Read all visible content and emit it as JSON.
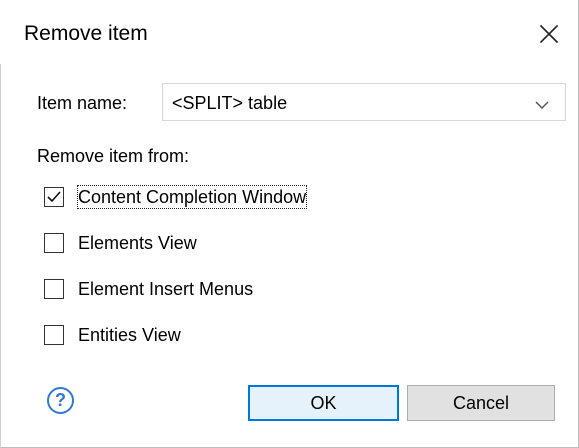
{
  "dialog": {
    "title": "Remove item",
    "close_icon": "close-icon",
    "item_name": {
      "label": "Item name:",
      "value": "<SPLIT> table",
      "dropdown_icon": "chevron-down-icon"
    },
    "remove_from_label": "Remove item from:",
    "options": [
      {
        "label": "Content Completion Window",
        "checked": true
      },
      {
        "label": "Elements View",
        "checked": false
      },
      {
        "label": "Element Insert Menus",
        "checked": false
      },
      {
        "label": "Entities View",
        "checked": false
      }
    ],
    "help_icon": "help-icon",
    "buttons": {
      "ok": "OK",
      "cancel": "Cancel"
    }
  },
  "colors": {
    "accent": "#0078d7",
    "help": "#2f78d6",
    "button": "#e1e1e1"
  }
}
